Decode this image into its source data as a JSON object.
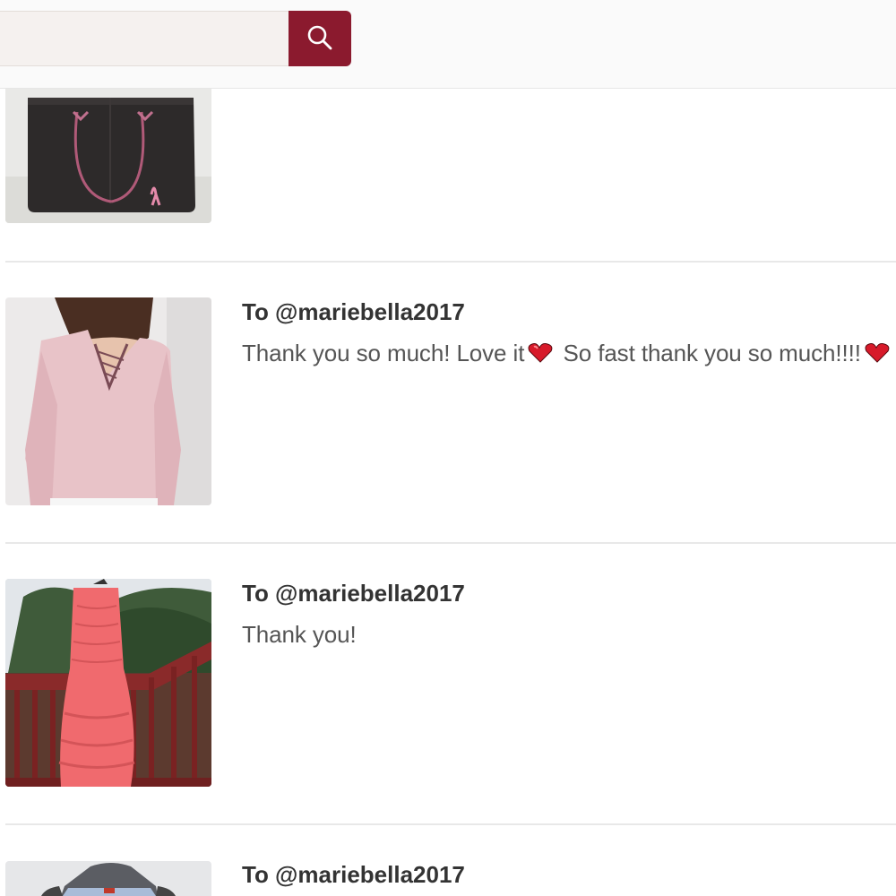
{
  "search": {
    "value": "",
    "placeholder": ""
  },
  "colors": {
    "accent": "#8b1a2e",
    "header_bg": "#fafafa",
    "input_bg": "#f5f1ef",
    "divider": "#e8e8e8"
  },
  "icons": {
    "search": "magnifier-icon",
    "heart": "heart-emoji-icon"
  },
  "feed": {
    "items": [
      {
        "product": "black tote bag with pink ribbon",
        "recipient": "",
        "message": ""
      },
      {
        "product": "pink lace-up knit sweater",
        "recipient": "To @mariebella2017",
        "message_part1": "Thank you so much! Love it",
        "message_part2": " So fast thank you so much!!!!"
      },
      {
        "product": "coral ruffled strapless gown",
        "recipient": "To @mariebella2017",
        "message": "Thank you!"
      },
      {
        "product": "light blue dress on hanger",
        "recipient": "To @mariebella2017",
        "message": ""
      }
    ]
  }
}
